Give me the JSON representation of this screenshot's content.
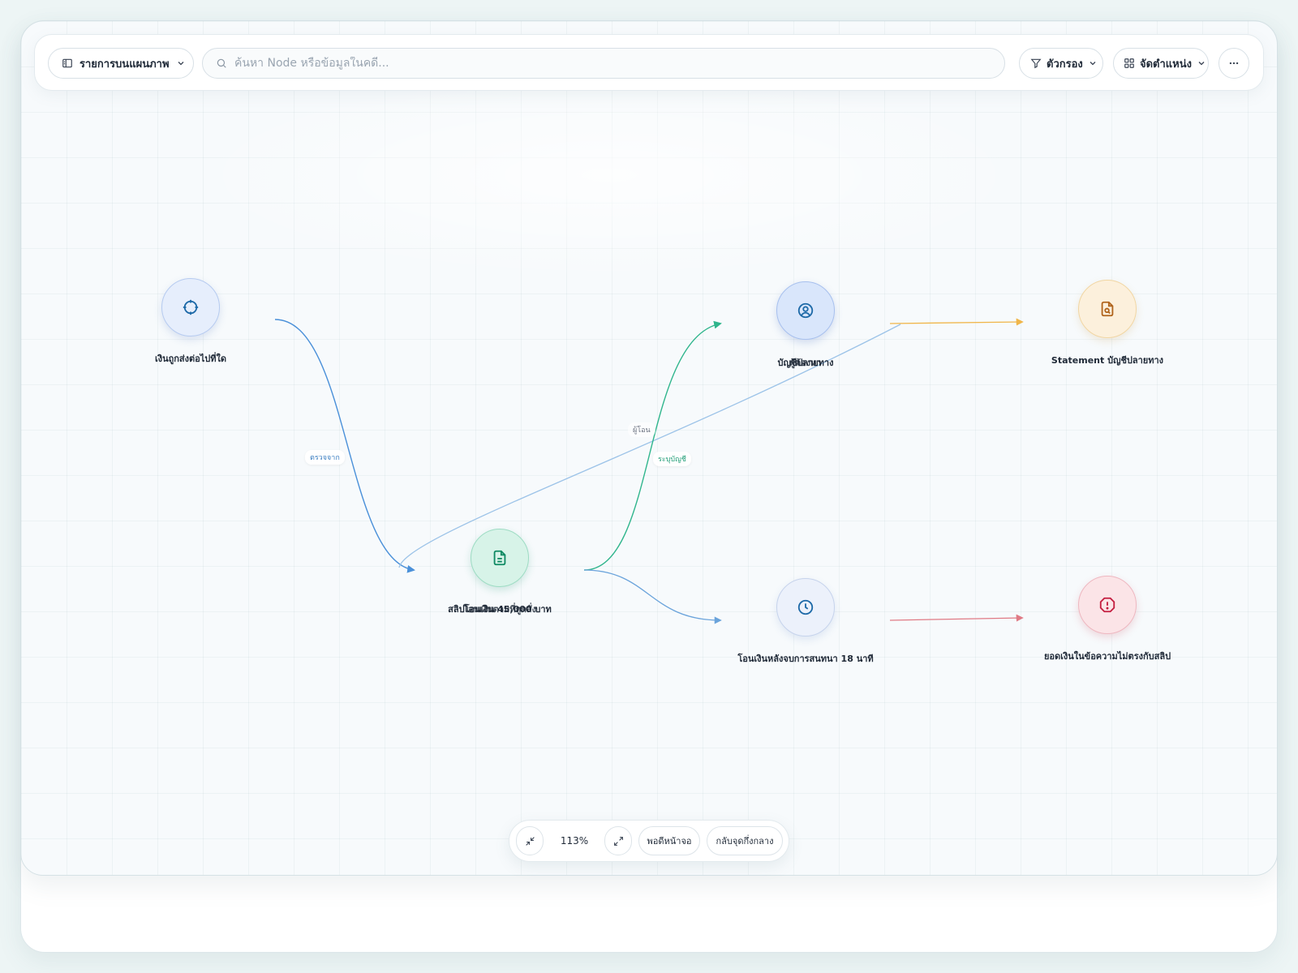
{
  "toolbar": {
    "items_label": "รายการบนแผนภาพ",
    "search_placeholder": "ค้นหา Node หรือข้อมูลในคดี...",
    "filter_label": "ตัวกรอง",
    "arrange_label": "จัดตำแหน่ง",
    "more_icon": "more-horizontal-icon"
  },
  "nodes": {
    "money_destination": {
      "label": "เงินถูกส่งต่อไปที่ใด",
      "icon": "crosshair-icon"
    },
    "transfer_slip": {
      "label": "สลิปโอนเงิน 45,000 บาท",
      "label_overlap": "โอนเงินตามที่ถูกสั่ง",
      "icon": "document-icon"
    },
    "destination_account": {
      "label": "บัญชีปลายทาง",
      "label_overlap": "ผู้ต้องหา",
      "icon": "user-circle-icon"
    },
    "statement": {
      "label": "Statement บัญชีปลายทาง",
      "icon": "file-search-icon"
    },
    "transfer_time": {
      "label": "โอนเงินหลังจบการสนทนา 18 นาที",
      "icon": "clock-icon"
    },
    "mismatch": {
      "label": "ยอดเงินในข้อความไม่ตรงกับสลิป",
      "icon": "alert-circle-icon"
    }
  },
  "edge_labels": {
    "checked_from": "ตรวจจาก",
    "transferer": "ผู้โอน",
    "specified_account": "ระบุบัญชี"
  },
  "zoom": {
    "zoom_out_icon": "minimize-icon",
    "level": "113%",
    "zoom_in_icon": "maximize-icon",
    "fit_label": "พอดีหน้าจอ",
    "center_label": "กลับจุดกึ่งกลาง"
  },
  "colors": {
    "blue_edge": "#4a90d9",
    "green_edge": "#2fb58c",
    "amber_edge": "#f0b64a",
    "red_edge": "#e07a85",
    "light_blue_edge": "#9cc3e8"
  }
}
